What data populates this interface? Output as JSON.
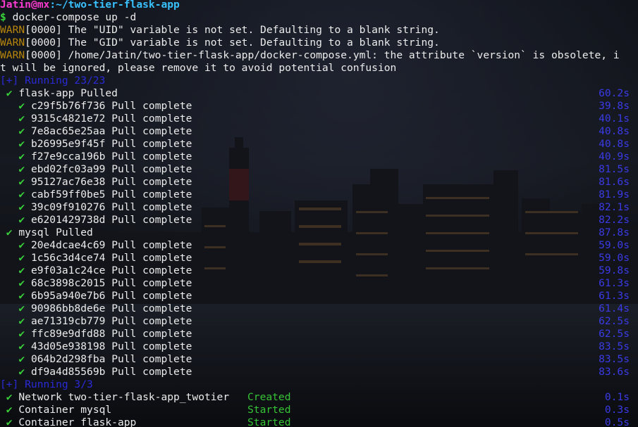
{
  "prompt": {
    "user": "Jatin",
    "at": "@",
    "host": "mx",
    "sep": ":",
    "cwd": "~/two-tier-flask-app",
    "symbol": "$",
    "command": "docker-compose up -d"
  },
  "warnings": [
    {
      "level": "WARN",
      "text": "[0000] The \"UID\" variable is not set. Defaulting to a blank string."
    },
    {
      "level": "WARN",
      "text": "[0000] The \"GID\" variable is not set. Defaulting to a blank string."
    },
    {
      "level": "WARN",
      "text": "[0000] /home/Jatin/two-tier-flask-app/docker-compose.yml: the attribute `version` is obsolete, i"
    }
  ],
  "warning_wrap": "t will be ignored, please remove it to avoid potential confusion",
  "running_header_1": "[+] Running 23/23",
  "check": "✔",
  "services": [
    {
      "name": "flask-app Pulled",
      "time": "60.2s",
      "layers": [
        {
          "id": "c29f5b76f736",
          "status": "Pull complete",
          "time": "39.8s"
        },
        {
          "id": "9315c4821e72",
          "status": "Pull complete",
          "time": "40.1s"
        },
        {
          "id": "7e8ac65e25aa",
          "status": "Pull complete",
          "time": "40.8s"
        },
        {
          "id": "b26995e9f45f",
          "status": "Pull complete",
          "time": "40.8s"
        },
        {
          "id": "f27e9cca196b",
          "status": "Pull complete",
          "time": "40.9s"
        },
        {
          "id": "ebd02fc03a99",
          "status": "Pull complete",
          "time": "81.5s"
        },
        {
          "id": "95127ac76e38",
          "status": "Pull complete",
          "time": "81.6s"
        },
        {
          "id": "cabf59ff0be5",
          "status": "Pull complete",
          "time": "81.9s"
        },
        {
          "id": "39c09f910276",
          "status": "Pull complete",
          "time": "82.1s"
        },
        {
          "id": "e6201429738d",
          "status": "Pull complete",
          "time": "82.2s"
        }
      ]
    },
    {
      "name": "mysql Pulled",
      "time": "87.8s",
      "layers": [
        {
          "id": "20e4dcae4c69",
          "status": "Pull complete",
          "time": "59.0s"
        },
        {
          "id": "1c56c3d4ce74",
          "status": "Pull complete",
          "time": "59.0s"
        },
        {
          "id": "e9f03a1c24ce",
          "status": "Pull complete",
          "time": "59.8s"
        },
        {
          "id": "68c3898c2015",
          "status": "Pull complete",
          "time": "61.3s"
        },
        {
          "id": "6b95a940e7b6",
          "status": "Pull complete",
          "time": "61.3s"
        },
        {
          "id": "90986bb8de6e",
          "status": "Pull complete",
          "time": "61.4s"
        },
        {
          "id": "ae71319cb779",
          "status": "Pull complete",
          "time": "62.5s"
        },
        {
          "id": "ffc89e9dfd88",
          "status": "Pull complete",
          "time": "62.5s"
        },
        {
          "id": "43d05e938198",
          "status": "Pull complete",
          "time": "83.5s"
        },
        {
          "id": "064b2d298fba",
          "status": "Pull complete",
          "time": "83.5s"
        },
        {
          "id": "df9a4d85569b",
          "status": "Pull complete",
          "time": "83.6s"
        }
      ]
    }
  ],
  "running_header_2": "[+] Running 3/3",
  "resources": [
    {
      "name": "Network two-tier-flask-app_twotier",
      "status": "Created",
      "time": "0.1s"
    },
    {
      "name": "Container mysql",
      "status": "Started",
      "time": "0.3s"
    },
    {
      "name": "Container flask-app",
      "status": "Started",
      "time": "0.5s"
    }
  ],
  "colors": {
    "prompt_user": "#ff3bd0",
    "prompt_path": "#39c0ff",
    "warn": "#b8860b",
    "check": "#39d139",
    "time": "#3a3ae6",
    "status": "#35c435",
    "header": "#2a2ad8"
  }
}
